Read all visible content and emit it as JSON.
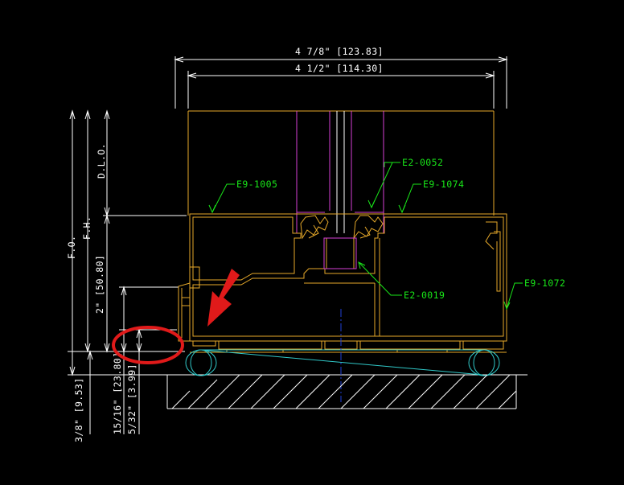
{
  "dimensions": {
    "overall_width": "4 7/8\" [123.83]",
    "inner_width": "4 1/2\" [114.30]",
    "fo": "F.O.",
    "fh": "F.H.",
    "dlo": "D.L.O.",
    "two_in": "2\" [50.80]",
    "three_eighths": "3/8\" [9.53]",
    "fifteen_sixteenths": "15/16\" [23.80]",
    "five_thirtyseconds": "5/32\" [3.99]"
  },
  "callouts": {
    "e9_1005": "E9-1005",
    "e2_0052": "E2-0052",
    "e9_1074": "E9-1074",
    "e2_0019": "E2-0019",
    "e9_1072": "E9-1072"
  },
  "colors": {
    "background": "#000000",
    "frame": "#e6a92a",
    "glass": "#d63fd6",
    "callout": "#19e619",
    "dimension": "#ffffff",
    "setting_block": "#30c8c8",
    "centerline": "#1f3fd6",
    "highlight": "#e01a1a"
  }
}
